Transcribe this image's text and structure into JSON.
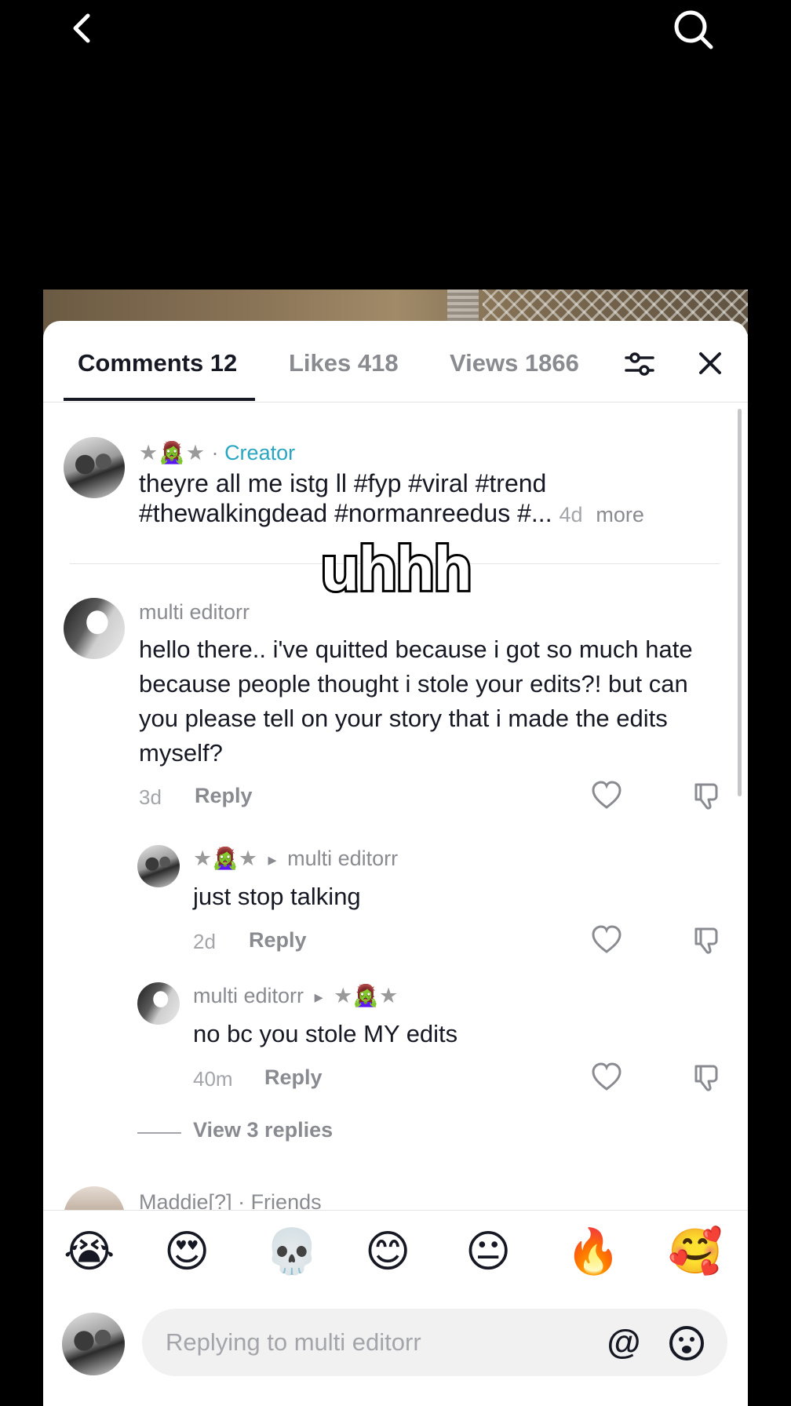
{
  "tabs": {
    "comments": "Comments 12",
    "likes": "Likes 418",
    "views": "Views 1866"
  },
  "overlay_text": "uhhh",
  "creator_post": {
    "name": "★🧟‍♀️★",
    "separator": "·",
    "tag": "Creator",
    "caption_line1": "theyre all me istg ll #fyp #viral #trend",
    "caption_line2": "#thewalkingdead #normanreedus #...",
    "time": "4d",
    "more": "more"
  },
  "comments": [
    {
      "user": "multi editorr",
      "text": "hello there.. i've quitted because i got so much hate because people thought i stole your edits?! but can you please tell on your story that i made the edits myself?",
      "time": "3d",
      "reply": "Reply"
    }
  ],
  "replies": [
    {
      "user": "★🧟‍♀️★",
      "arrow": "▸",
      "to": "multi editorr",
      "text": "just stop talking",
      "time": "2d",
      "reply": "Reply"
    },
    {
      "user": "multi editorr",
      "arrow": "▸",
      "to": "★🧟‍♀️★",
      "text": "no bc you stole MY edits",
      "time": "40m",
      "reply": "Reply"
    }
  ],
  "view_replies": "View 3 replies",
  "next_comment_user": "Maddie[?] · Friends",
  "emoji_bar": [
    "😭",
    "😍",
    "💀",
    "😊",
    "😐",
    "🔥",
    "🥰"
  ],
  "input": {
    "placeholder": "Replying to multi editorr",
    "at_symbol": "@"
  },
  "colors": {
    "creator_tag": "#2aa6c2",
    "secondary_text": "#8a8b91",
    "primary_text": "#161823"
  },
  "icons": [
    "back-icon",
    "search-icon",
    "filter-icon",
    "close-icon",
    "heart-icon",
    "dislike-icon",
    "emoji-icon"
  ]
}
